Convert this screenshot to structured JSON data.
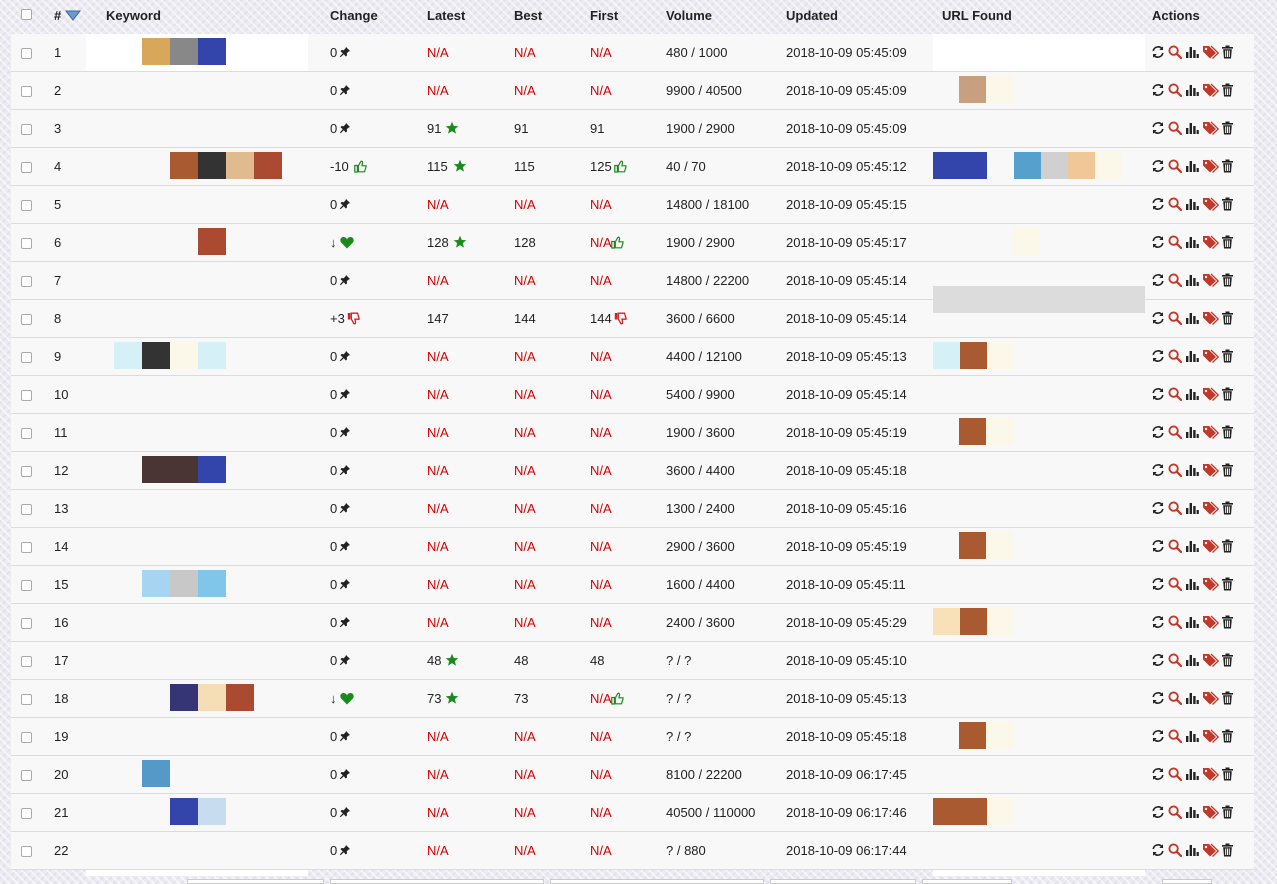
{
  "header": {
    "checkbox": "",
    "num": "#",
    "keyword": "Keyword",
    "change": "Change",
    "latest": "Latest",
    "best": "Best",
    "first": "First",
    "volume": "Volume",
    "updated": "Updated",
    "url": "URL Found",
    "actions": "Actions"
  },
  "colors": {
    "na_red": "#d40000",
    "star_green": "#1a8a1a",
    "thumb_red": "#d42020",
    "tag_red": "#c0392b"
  },
  "rows": [
    {
      "n": "1",
      "change": "0",
      "change_icon": "pin",
      "latest": "N/A",
      "latest_star": false,
      "best": "N/A",
      "first": "N/A",
      "first_icon": "",
      "volume": "480 / 1000",
      "updated": "2018-10-09 05:45:09"
    },
    {
      "n": "2",
      "change": "0",
      "change_icon": "pin",
      "latest": "N/A",
      "latest_star": false,
      "best": "N/A",
      "first": "N/A",
      "first_icon": "",
      "volume": "9900 / 40500",
      "updated": "2018-10-09 05:45:09"
    },
    {
      "n": "3",
      "change": "0",
      "change_icon": "pin",
      "latest": "91",
      "latest_star": true,
      "best": "91",
      "first": "91",
      "first_icon": "",
      "volume": "1900 / 2900",
      "updated": "2018-10-09 05:45:09"
    },
    {
      "n": "4",
      "change": "-10",
      "change_icon": "thumb-up",
      "latest": "115",
      "latest_star": true,
      "best": "115",
      "first": "125",
      "first_icon": "thumb-up",
      "volume": "40 / 70",
      "updated": "2018-10-09 05:45:12"
    },
    {
      "n": "5",
      "change": "0",
      "change_icon": "pin",
      "latest": "N/A",
      "latest_star": false,
      "best": "N/A",
      "first": "N/A",
      "first_icon": "",
      "volume": "14800 / 18100",
      "updated": "2018-10-09 05:45:15"
    },
    {
      "n": "6",
      "change": "↓",
      "change_icon": "heart",
      "latest": "128",
      "latest_star": true,
      "best": "128",
      "first": "N/A",
      "first_icon": "thumb-up",
      "volume": "1900 / 2900",
      "updated": "2018-10-09 05:45:17"
    },
    {
      "n": "7",
      "change": "0",
      "change_icon": "pin",
      "latest": "N/A",
      "latest_star": false,
      "best": "N/A",
      "first": "N/A",
      "first_icon": "",
      "volume": "14800 / 22200",
      "updated": "2018-10-09 05:45:14"
    },
    {
      "n": "8",
      "change": "+3",
      "change_icon": "thumb-down",
      "latest": "147",
      "latest_star": false,
      "best": "144",
      "first": "144",
      "first_icon": "thumb-down",
      "volume": "3600 / 6600",
      "updated": "2018-10-09 05:45:14"
    },
    {
      "n": "9",
      "change": "0",
      "change_icon": "pin",
      "latest": "N/A",
      "latest_star": false,
      "best": "N/A",
      "first": "N/A",
      "first_icon": "",
      "volume": "4400 / 12100",
      "updated": "2018-10-09 05:45:13"
    },
    {
      "n": "10",
      "change": "0",
      "change_icon": "pin",
      "latest": "N/A",
      "latest_star": false,
      "best": "N/A",
      "first": "N/A",
      "first_icon": "",
      "volume": "5400 / 9900",
      "updated": "2018-10-09 05:45:14"
    },
    {
      "n": "11",
      "change": "0",
      "change_icon": "pin",
      "latest": "N/A",
      "latest_star": false,
      "best": "N/A",
      "first": "N/A",
      "first_icon": "",
      "volume": "1900 / 3600",
      "updated": "2018-10-09 05:45:19"
    },
    {
      "n": "12",
      "change": "0",
      "change_icon": "pin",
      "latest": "N/A",
      "latest_star": false,
      "best": "N/A",
      "first": "N/A",
      "first_icon": "",
      "volume": "3600 / 4400",
      "updated": "2018-10-09 05:45:18"
    },
    {
      "n": "13",
      "change": "0",
      "change_icon": "pin",
      "latest": "N/A",
      "latest_star": false,
      "best": "N/A",
      "first": "N/A",
      "first_icon": "",
      "volume": "1300 / 2400",
      "updated": "2018-10-09 05:45:16"
    },
    {
      "n": "14",
      "change": "0",
      "change_icon": "pin",
      "latest": "N/A",
      "latest_star": false,
      "best": "N/A",
      "first": "N/A",
      "first_icon": "",
      "volume": "2900 / 3600",
      "updated": "2018-10-09 05:45:19"
    },
    {
      "n": "15",
      "change": "0",
      "change_icon": "pin",
      "latest": "N/A",
      "latest_star": false,
      "best": "N/A",
      "first": "N/A",
      "first_icon": "",
      "volume": "1600 / 4400",
      "updated": "2018-10-09 05:45:11"
    },
    {
      "n": "16",
      "change": "0",
      "change_icon": "pin",
      "latest": "N/A",
      "latest_star": false,
      "best": "N/A",
      "first": "N/A",
      "first_icon": "",
      "volume": "2400 / 3600",
      "updated": "2018-10-09 05:45:29"
    },
    {
      "n": "17",
      "change": "0",
      "change_icon": "pin",
      "latest": "48",
      "latest_star": true,
      "best": "48",
      "first": "48",
      "first_icon": "",
      "volume": "? / ?",
      "updated": "2018-10-09 05:45:10"
    },
    {
      "n": "18",
      "change": "↓",
      "change_icon": "heart",
      "latest": "73",
      "latest_star": true,
      "best": "73",
      "first": "N/A",
      "first_icon": "thumb-up",
      "volume": "? / ?",
      "updated": "2018-10-09 05:45:13"
    },
    {
      "n": "19",
      "change": "0",
      "change_icon": "pin",
      "latest": "N/A",
      "latest_star": false,
      "best": "N/A",
      "first": "N/A",
      "first_icon": "",
      "volume": "? / ?",
      "updated": "2018-10-09 05:45:18"
    },
    {
      "n": "20",
      "change": "0",
      "change_icon": "pin",
      "latest": "N/A",
      "latest_star": false,
      "best": "N/A",
      "first": "N/A",
      "first_icon": "",
      "volume": "8100 / 22200",
      "updated": "2018-10-09 06:17:45"
    },
    {
      "n": "21",
      "change": "0",
      "change_icon": "pin",
      "latest": "N/A",
      "latest_star": false,
      "best": "N/A",
      "first": "N/A",
      "first_icon": "",
      "volume": "40500 / 110000",
      "updated": "2018-10-09 06:17:46"
    },
    {
      "n": "22",
      "change": "0",
      "change_icon": "pin",
      "latest": "N/A",
      "latest_star": false,
      "best": "N/A",
      "first": "N/A",
      "first_icon": "",
      "volume": "? / 880",
      "updated": "2018-10-09 06:17:44"
    }
  ],
  "actions": [
    "refresh-icon",
    "search-icon",
    "bar-chart-icon",
    "tag-icon",
    "trash-icon"
  ],
  "keyword_redactions": [
    {
      "row": 1,
      "colors": [
        "#d8a85a",
        "#888888",
        "#3344aa"
      ]
    },
    {
      "row": 4,
      "colors": [
        "#aa5a30",
        "#333333",
        "#e0bb90",
        "#aa4a30"
      ]
    },
    {
      "row": 6,
      "colors": [
        "#aa4a30"
      ]
    },
    {
      "row": 9,
      "colors": [
        "#d6f0f8",
        "#333333",
        "#fbf8ea",
        "#d6f0f8"
      ]
    },
    {
      "row": 12,
      "colors": [
        "#4a3535",
        "#4a3535",
        "#3344aa"
      ]
    },
    {
      "row": 15,
      "colors": [
        "#a5d5f0",
        "#c8c8c8",
        "#80c5ea"
      ]
    },
    {
      "row": 18,
      "colors": [
        "#353575",
        "#f5ddb5",
        "#aa4a30"
      ]
    },
    {
      "row": 20,
      "colors": [
        "#5599c8"
      ]
    },
    {
      "row": 21,
      "colors": [
        "#3344aa",
        "#c8dcf0"
      ]
    }
  ],
  "url_redactions": [
    {
      "row": 2,
      "colors": [
        "#c8a080",
        "#fbf8ea"
      ]
    },
    {
      "row": 4,
      "colors": [
        "#3344aa",
        "#3344aa",
        "#f8f8f8",
        "#55a0cc",
        "#d0d0d0",
        "#f0c898",
        "#fbf8ea"
      ]
    },
    {
      "row": 6,
      "colors": [
        "#fbf8ea"
      ]
    },
    {
      "row": 9,
      "colors": [
        "#d6f0f8",
        "#aa5a30",
        "#fbf8ea"
      ]
    },
    {
      "row": 11,
      "colors": [
        "#aa5a30",
        "#fbf8ea"
      ]
    },
    {
      "row": 14,
      "colors": [
        "#aa5a30",
        "#fbf8ea"
      ]
    },
    {
      "row": 16,
      "colors": [
        "#f8e0b8",
        "#aa5a30",
        "#fbf8ea"
      ]
    },
    {
      "row": 19,
      "colors": [
        "#aa5a30",
        "#fbf8ea"
      ]
    },
    {
      "row": 21,
      "colors": [
        "#aa5a30",
        "#aa5a30",
        "#fbf8ea"
      ]
    }
  ]
}
